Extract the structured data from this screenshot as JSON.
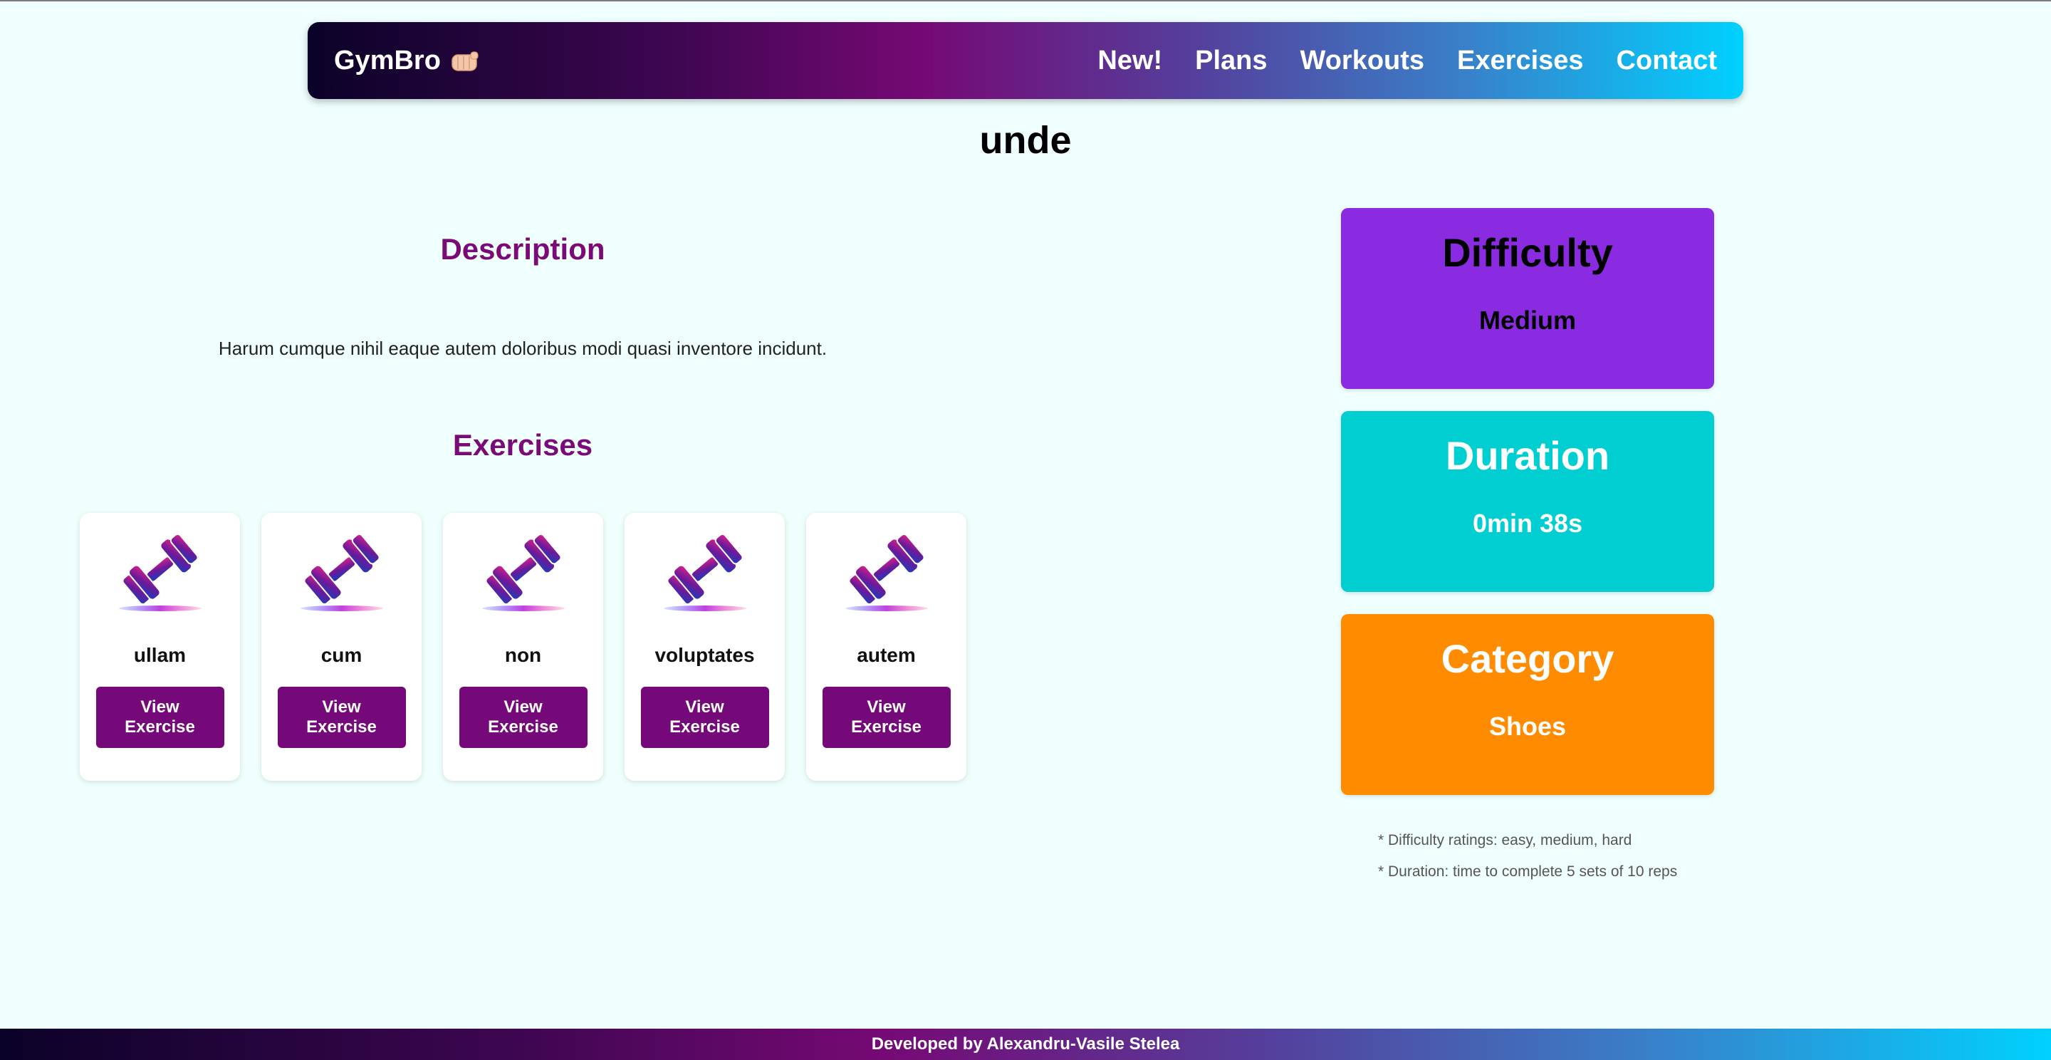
{
  "header": {
    "brand": "GymBro",
    "brand_icon": "fist-bump-icon",
    "nav": [
      {
        "label": "New!"
      },
      {
        "label": "Plans"
      },
      {
        "label": "Workouts"
      },
      {
        "label": "Exercises"
      },
      {
        "label": "Contact"
      }
    ],
    "gradient_colors": [
      "#0b0228",
      "#760975",
      "#00d1ff"
    ]
  },
  "page": {
    "title": "unde"
  },
  "description": {
    "heading": "Description",
    "text": "Harum cumque nihil eaque autem doloribus modi quasi inventore incidunt."
  },
  "exercises": {
    "heading": "Exercises",
    "items": [
      {
        "name": "ullam",
        "button_label": "View Exercise",
        "icon": "dumbbell-icon"
      },
      {
        "name": "cum",
        "button_label": "View Exercise",
        "icon": "dumbbell-icon"
      },
      {
        "name": "non",
        "button_label": "View Exercise",
        "icon": "dumbbell-icon"
      },
      {
        "name": "voluptates",
        "button_label": "View Exercise",
        "icon": "dumbbell-icon"
      },
      {
        "name": "autem",
        "button_label": "View Exercise",
        "icon": "dumbbell-icon"
      }
    ],
    "button_color": "#76097a"
  },
  "stats": {
    "difficulty": {
      "title": "Difficulty",
      "value": "Medium",
      "color": "#8a2be2"
    },
    "duration": {
      "title": "Duration",
      "value": "0min 38s",
      "color": "#00ced1"
    },
    "category": {
      "title": "Category",
      "value": "Shoes",
      "color": "#ff8c00"
    }
  },
  "notes": [
    "* Difficulty ratings: easy, medium, hard",
    "* Duration: time to complete 5 sets of 10 reps"
  ],
  "footer": {
    "text": "Developed by Alexandru-Vasile Stelea"
  }
}
